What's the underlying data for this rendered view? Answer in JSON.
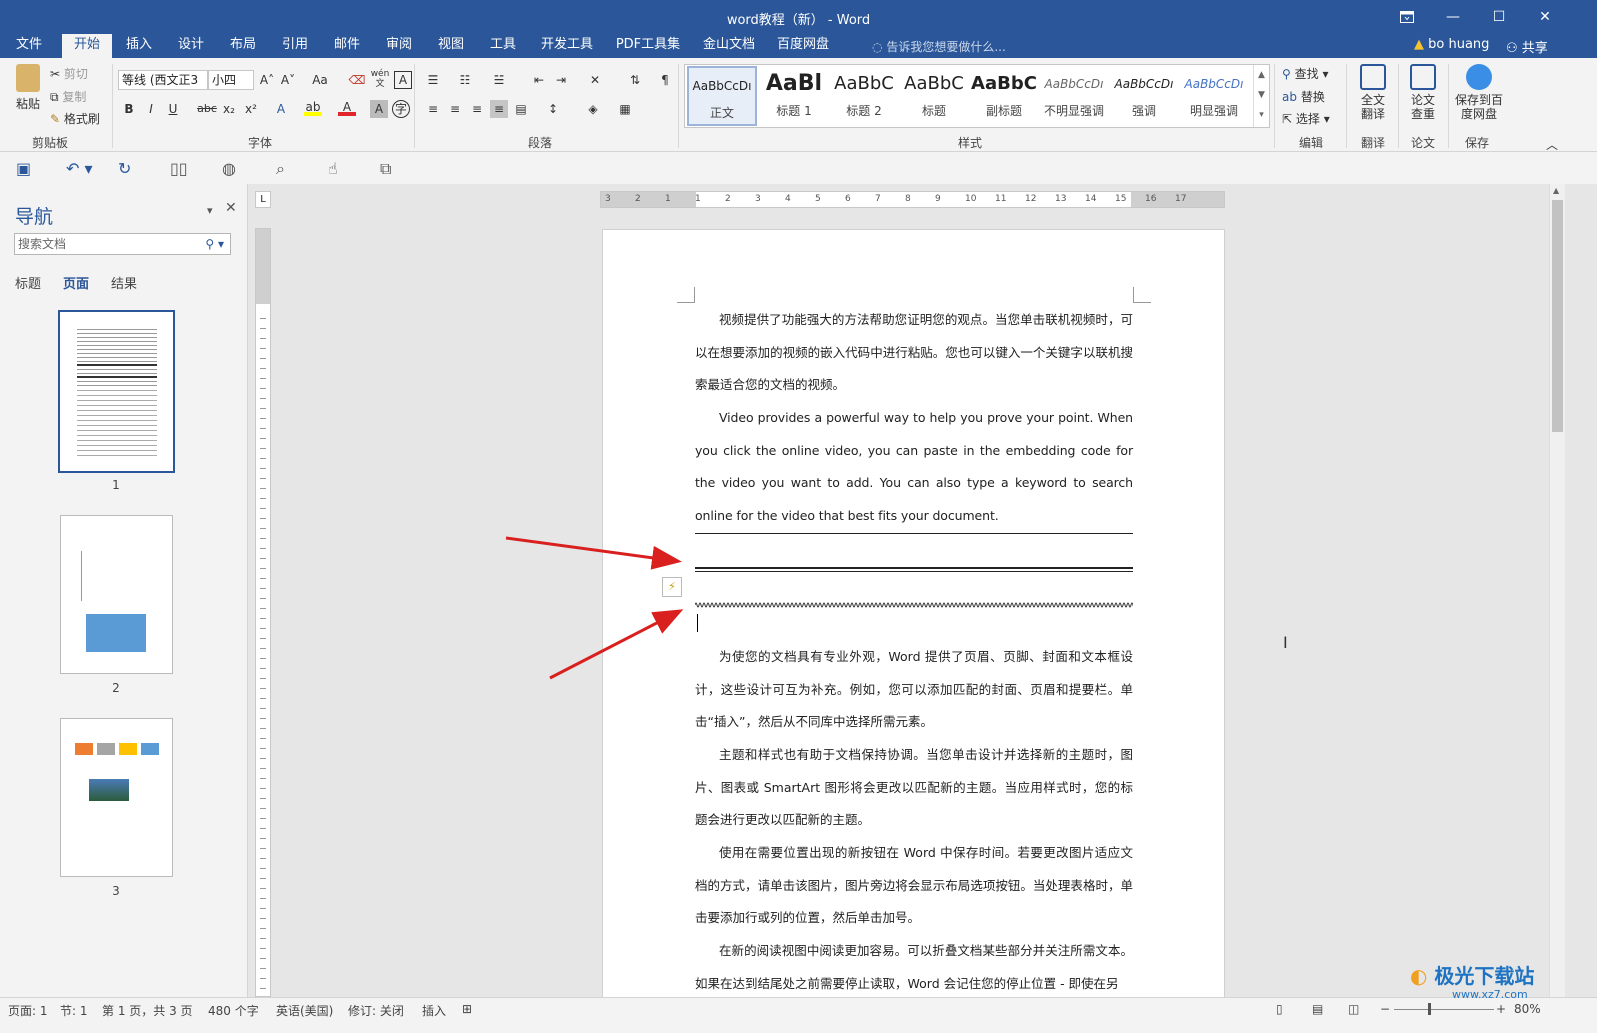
{
  "window": {
    "title": "word教程（新） - Word",
    "restore_icon": "ribbon-display-icon",
    "minimize": "—",
    "maximize": "☐",
    "close": "✕"
  },
  "tabs": [
    "文件",
    "开始",
    "插入",
    "设计",
    "布局",
    "引用",
    "邮件",
    "审阅",
    "视图",
    "工具",
    "开发工具",
    "PDF工具集",
    "金山文档",
    "百度网盘"
  ],
  "tell_me": "告诉我您想要做什么...",
  "user": {
    "name": "bo huang",
    "share": "共享"
  },
  "clipboard": {
    "paste": "粘贴",
    "cut": "剪切",
    "copy": "复制",
    "painter": "格式刷",
    "label": "剪贴板"
  },
  "font": {
    "name": "等线 (西文正3",
    "size": "小四",
    "label": "字体",
    "wen": "wén 文",
    "case": "Aa"
  },
  "paragraph": {
    "label": "段落"
  },
  "styles": {
    "label": "样式",
    "items": [
      {
        "sample": "AaBbCcDı",
        "name": "正文"
      },
      {
        "sample": "AaBl",
        "name": "标题 1"
      },
      {
        "sample": "AaBbC",
        "name": "标题 2"
      },
      {
        "sample": "AaBbC",
        "name": "标题"
      },
      {
        "sample": "AaBbC",
        "name": "副标题"
      },
      {
        "sample": "AaBbCcDı",
        "name": "不明显强调"
      },
      {
        "sample": "AaBbCcDı",
        "name": "强调"
      },
      {
        "sample": "AaBbCcDı",
        "name": "明显强调"
      }
    ]
  },
  "editing": {
    "find": "查找",
    "replace": "替换",
    "select": "选择",
    "label": "编辑"
  },
  "translate": {
    "btn": "全文翻译",
    "label": "翻译"
  },
  "paper": {
    "btn": "论文查重",
    "label": "论文"
  },
  "save_group": {
    "btn": "保存到百度网盘",
    "label": "保存"
  },
  "nav": {
    "title": "导航",
    "search_placeholder": "搜索文档",
    "tabs": [
      "标题",
      "页面",
      "结果"
    ],
    "pages": [
      "1",
      "2",
      "3"
    ]
  },
  "document": {
    "p1": "视频提供了功能强大的方法帮助您证明您的观点。当您单击联机视频时，可以在想要添加的视频的嵌入代码中进行粘贴。您也可以键入一个关键字以联机搜索最适合您的文档的视频。",
    "p2": "Video provides a powerful way to help you prove your point. When you click the online video, you can paste in the embedding code for the video you want to add. You can also type a keyword to search online for the video that best fits your document.",
    "p3": "为使您的文档具有专业外观，Word 提供了页眉、页脚、封面和文本框设计，这些设计可互为补充。例如，您可以添加匹配的封面、页眉和提要栏。单击“插入”，然后从不同库中选择所需元素。",
    "p4": "主题和样式也有助于文档保持协调。当您单击设计并选择新的主题时，图片、图表或 SmartArt 图形将会更改以匹配新的主题。当应用样式时，您的标题会进行更改以匹配新的主题。",
    "p5": "使用在需要位置出现的新按钮在 Word 中保存时间。若要更改图片适应文档的方式，请单击该图片，图片旁边将会显示布局选项按钮。当处理表格时，单击要添加行或列的位置，然后单击加号。",
    "p6": "在新的阅读视图中阅读更加容易。可以折叠文档某些部分并关注所需文本。如果在达到结尾处之前需要停止读取，Word 会记住您的停止位置 - 即使在另"
  },
  "ruler": {
    "h_ticks": [
      "3",
      "2",
      "1",
      "1",
      "2",
      "3",
      "4",
      "5",
      "6",
      "7",
      "8",
      "9",
      "10",
      "11",
      "12",
      "13",
      "14",
      "15",
      "16",
      "17"
    ]
  },
  "status": {
    "page": "页面: 1",
    "section": "节: 1",
    "pages": "第 1 页，共 3 页",
    "words": "480 个字",
    "lang": "英语(美国)",
    "track": "修订: 关闭",
    "insert": "插入",
    "zoom": "80%"
  },
  "watermark": {
    "main": "极光下载站",
    "sub": "www.xz7.com"
  },
  "colors": {
    "accent": "#2b579a",
    "arrow": "#d9201f",
    "highlight": "#ffff00",
    "fontcolor": "#e0262a"
  }
}
